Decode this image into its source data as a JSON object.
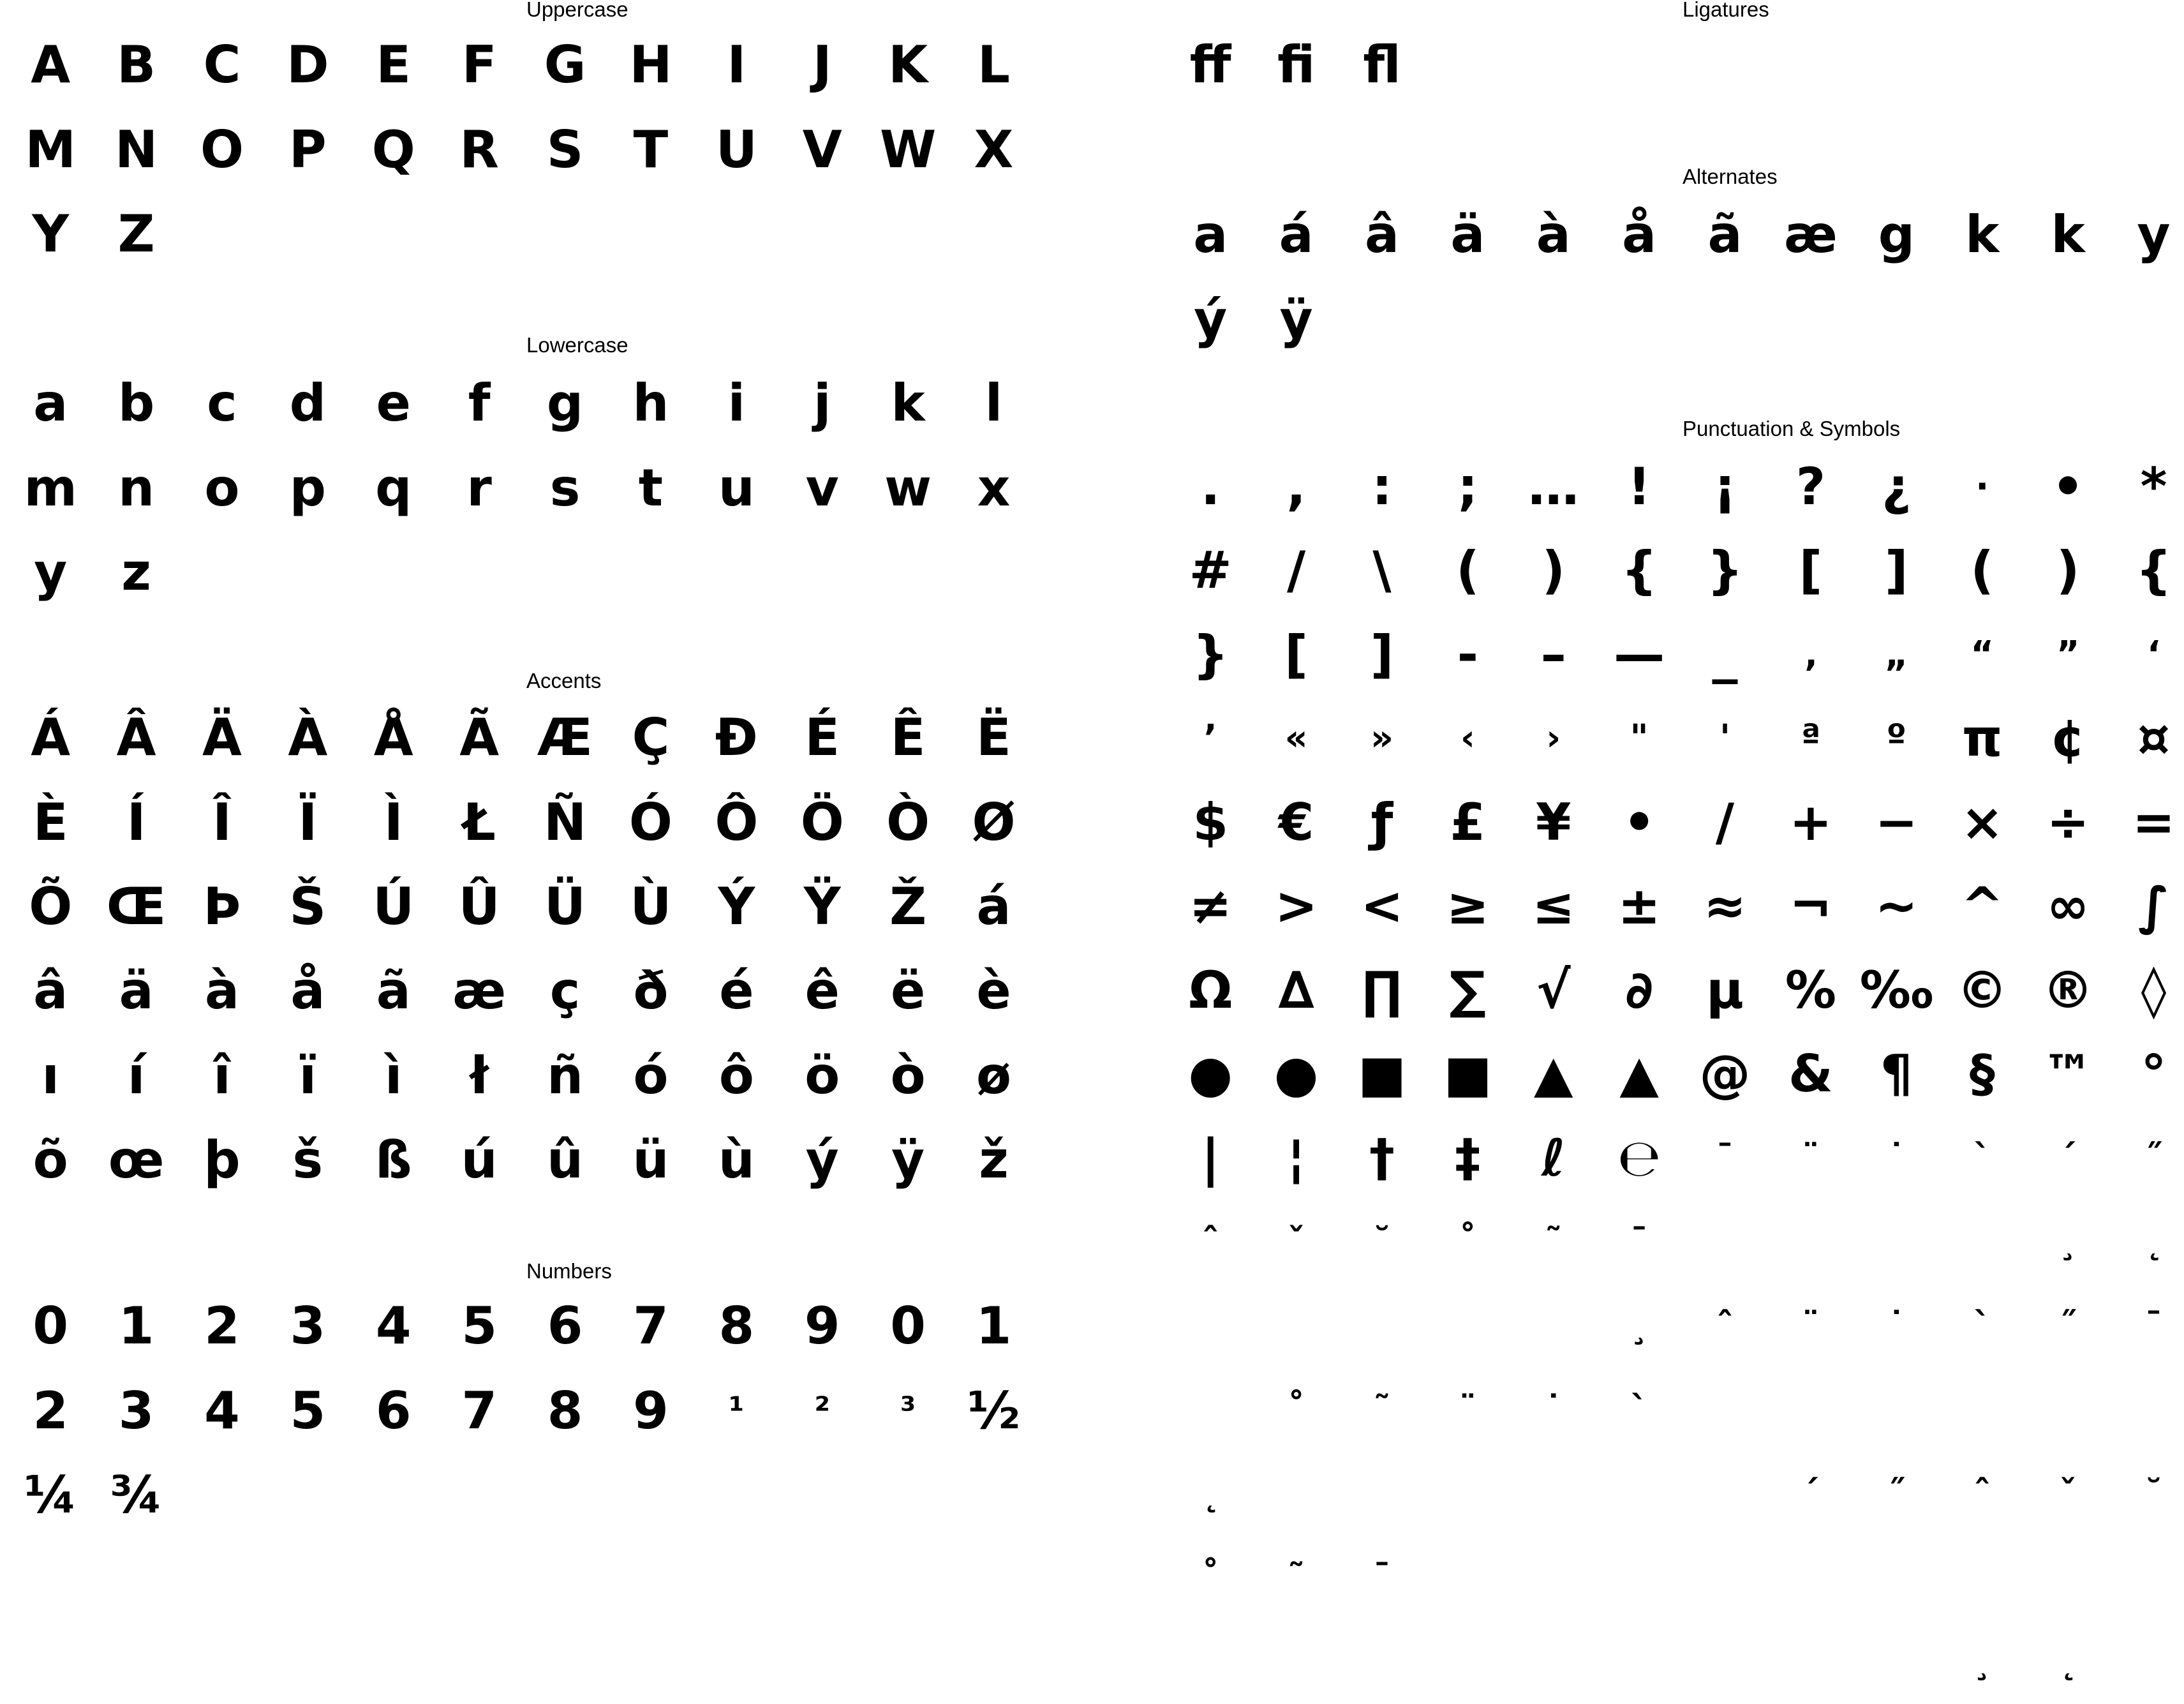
{
  "sections": {
    "uppercase": {
      "title": "Uppercase",
      "glyphs": [
        "A",
        "B",
        "C",
        "D",
        "E",
        "F",
        "G",
        "H",
        "I",
        "J",
        "K",
        "L",
        "M",
        "N",
        "O",
        "P",
        "Q",
        "R",
        "S",
        "T",
        "U",
        "V",
        "W",
        "X",
        "Y",
        "Z"
      ]
    },
    "lowercase": {
      "title": "Lowercase",
      "glyphs": [
        "a",
        "b",
        "c",
        "d",
        "e",
        "f",
        "g",
        "h",
        "i",
        "j",
        "k",
        "l",
        "m",
        "n",
        "o",
        "p",
        "q",
        "r",
        "s",
        "t",
        "u",
        "v",
        "w",
        "x",
        "y",
        "z"
      ]
    },
    "accents": {
      "title": "Accents",
      "glyphs": [
        "Á",
        "Â",
        "Ä",
        "À",
        "Å",
        "Ã",
        "Æ",
        "Ç",
        "Đ",
        "É",
        "Ê",
        "Ë",
        "È",
        "Í",
        "Î",
        "Ï",
        "Ì",
        "Ł",
        "Ñ",
        "Ó",
        "Ô",
        "Ö",
        "Ò",
        "Ø",
        "Õ",
        "Œ",
        "Þ",
        "Š",
        "Ú",
        "Û",
        "Ü",
        "Ù",
        "Ý",
        "Ÿ",
        "Ž",
        "á",
        "â",
        "ä",
        "à",
        "å",
        "ã",
        "æ",
        "ç",
        "ð",
        "é",
        "ê",
        "ë",
        "è",
        "ı",
        "í",
        "î",
        "ï",
        "ì",
        "ł",
        "ñ",
        "ó",
        "ô",
        "ö",
        "ò",
        "ø",
        "õ",
        "œ",
        "þ",
        "š",
        "ß",
        "ú",
        "û",
        "ü",
        "ù",
        "ý",
        "ÿ",
        "ž"
      ]
    },
    "numbers": {
      "title": "Numbers",
      "glyphs": [
        "0",
        "1",
        "2",
        "3",
        "4",
        "5",
        "6",
        "7",
        "8",
        "9",
        "0",
        "1",
        "2",
        "3",
        "4",
        "5",
        "6",
        "7",
        "8",
        "9",
        "¹",
        "²",
        "³",
        "½",
        "¼",
        "¾"
      ]
    },
    "ligatures": {
      "title": "Ligatures",
      "glyphs": [
        "ff",
        "fi",
        "fl"
      ]
    },
    "alternates": {
      "title": "Alternates",
      "glyphs": [
        "a",
        "á",
        "â",
        "ä",
        "à",
        "å",
        "ã",
        "æ",
        "g",
        "k",
        "k",
        "y",
        "ý",
        "ÿ"
      ]
    },
    "punctuation": {
      "title": "Punctuation & Symbols",
      "glyphs": [
        ".",
        ",",
        ":",
        ";",
        "…",
        "!",
        "¡",
        "?",
        "¿",
        "·",
        "•",
        "*",
        "#",
        "/",
        "\\",
        "(",
        ")",
        "{",
        "}",
        "[",
        "]",
        "(",
        ")",
        "{",
        "}",
        "[",
        "]",
        "-",
        "–",
        "—",
        "_",
        "‚",
        "„",
        "“",
        "”",
        "‘",
        "’",
        "«",
        "»",
        "‹",
        "›",
        "\"",
        "'",
        "ª",
        "º",
        "π",
        "¢",
        "¤",
        "$",
        "€",
        "ƒ",
        "£",
        "¥",
        "•",
        "∕",
        "+",
        "−",
        "×",
        "÷",
        "=",
        "≠",
        ">",
        "<",
        "≥",
        "≤",
        "±",
        "≈",
        "¬",
        "~",
        "^",
        "∞",
        "∫",
        "Ω",
        "∆",
        "∏",
        "∑",
        "√",
        "∂",
        "µ",
        "%",
        "‰",
        "©",
        "®",
        "◊",
        "●",
        "●",
        "■",
        "■",
        "▲",
        "▲",
        "@",
        "&",
        "¶",
        "§",
        "™",
        "°",
        "|",
        "¦",
        "†",
        "‡",
        "ℓ",
        "℮",
        "¯",
        "¨",
        "˙",
        "`",
        "´",
        "˝",
        "ˆ",
        "ˇ",
        "˘",
        "˚",
        "˜",
        "¯",
        "",
        "",
        "",
        "",
        "¸",
        "˛",
        "",
        "",
        "",
        "",
        "",
        "¸",
        "ˆ",
        "¨",
        "˙",
        "`",
        "˝",
        "¯",
        "",
        "˚",
        "˜",
        "¨",
        "˙",
        "`",
        "",
        "",
        "",
        "",
        "",
        "",
        "˛",
        "",
        "",
        "",
        "",
        "",
        "",
        "´",
        "˝",
        "ˆ",
        "ˇ",
        "˘",
        "˚",
        "˜",
        "¯",
        "",
        "",
        "",
        "",
        "",
        "",
        "",
        "",
        "",
        "",
        "",
        "",
        "",
        "",
        "",
        "",
        "",
        "",
        "¸",
        "˛"
      ]
    }
  }
}
